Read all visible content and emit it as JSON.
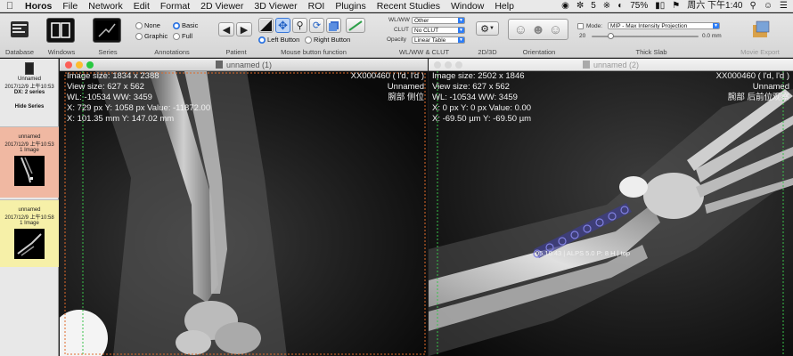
{
  "menubar": {
    "app": "Horos",
    "items": [
      "File",
      "Network",
      "Edit",
      "Format",
      "2D Viewer",
      "3D Viewer",
      "ROI",
      "Plugins",
      "Recent Studies",
      "Window",
      "Help"
    ],
    "status_count": "5",
    "battery": "75%",
    "clock": "周六 下午1:40"
  },
  "toolbar": {
    "groups": {
      "database": "Database",
      "windows": "Windows",
      "series": "Series",
      "annotations": "Annotations",
      "patient": "Patient",
      "mouse": "Mouse button function",
      "wlww": "WL/WW & CLUT",
      "d2d3": "2D/3D",
      "orientation": "Orientation",
      "thickslab": "Thick Slab",
      "movie": "Movie Export"
    },
    "annotations": {
      "none": "None",
      "basic": "Basic",
      "graphic": "Graphic",
      "full": "Full"
    },
    "mouse": {
      "left": "Left Button",
      "right": "Right Button"
    },
    "wlww": {
      "wlww_label": "WL/WW",
      "wlww_value": "Other",
      "clut_label": "CLUT",
      "clut_value": "No CLUT",
      "opacity_label": "Opacity",
      "opacity_value": "Linear Table"
    },
    "thickslab": {
      "mode_label": "Mode:",
      "mode_value": "MIP - Max Intensity Projection",
      "min_value": "20",
      "mm_value": "0.0 mm"
    }
  },
  "sidebar": {
    "top": {
      "name": "Unnamed",
      "date": "2017/12/9 上午10:53",
      "dx": "DX: 2 series",
      "hide": "Hide Series"
    },
    "cards": [
      {
        "name": "unnamed",
        "date": "2017/12/9 上午10:53",
        "count": "1 Image"
      },
      {
        "name": "unnamed",
        "date": "2017/12/9 上午10:58",
        "count": "1 Image"
      }
    ]
  },
  "viewer_left": {
    "title": "unnamed (1)",
    "info": [
      "Image size: 1834 x 2388",
      "View size: 627 x 562",
      "WL: -10534 WW: 3459",
      "X: 729 px Y: 1058 px Value: -11872.00",
      "X: 101.35 mm Y: 147.02 mm"
    ],
    "patient": [
      "XX000460 ( l'd, l'd )",
      "Unnamed",
      "腕部 侧位"
    ]
  },
  "viewer_right": {
    "title": "unnamed (2)",
    "info": [
      "Image size: 2502 x 1846",
      "View size: 627 x 562",
      "WL: -10534 WW: 3459",
      "X: 0 px Y: 0 px Value: 0.00",
      "X: -69.50 µm Y: -69.50 µm"
    ],
    "patient": [
      "XX000460 ( l'd, l'd )",
      "Unnamed",
      "腕部 后前位观察"
    ],
    "plate_label": "05.10.43 | ALPS 5.0 P: 8 H | top"
  }
}
